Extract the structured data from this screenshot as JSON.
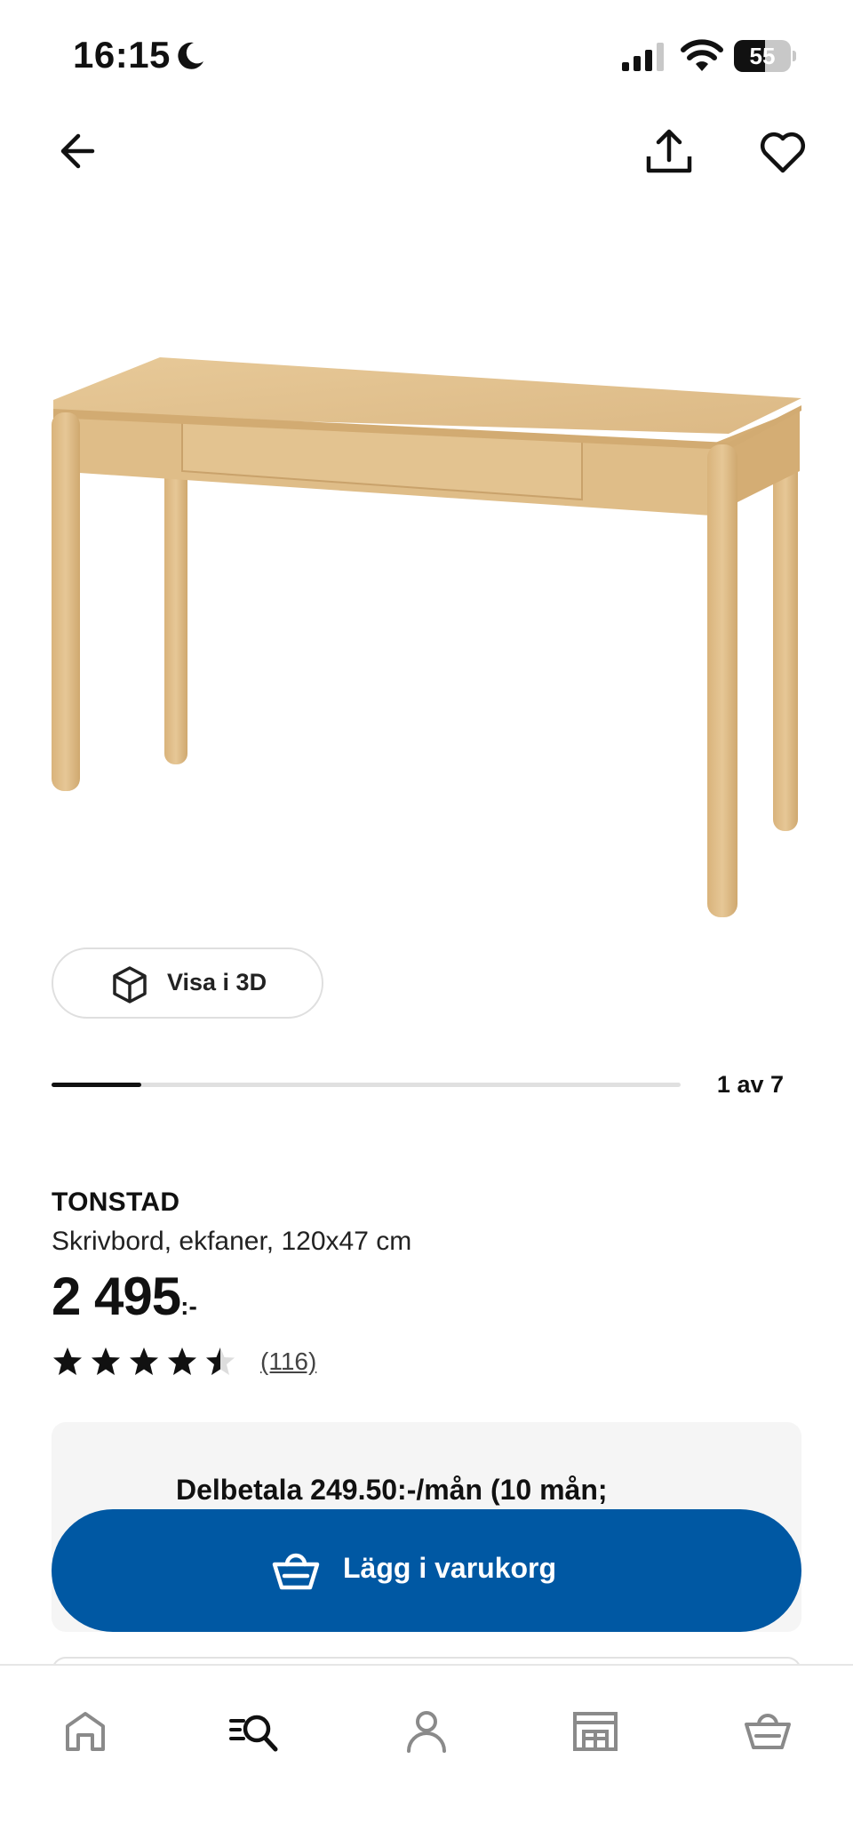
{
  "status_bar": {
    "time": "16:15",
    "battery_level": "55",
    "battery_fraction": 0.55,
    "icons": [
      "moon-icon",
      "signal-icon",
      "wifi-icon",
      "battery-icon"
    ]
  },
  "top_nav": {
    "icons": [
      "back-arrow-icon",
      "share-icon",
      "heart-icon"
    ]
  },
  "gallery": {
    "view_3d_label": "Visa i 3D",
    "counter": "1 av 7",
    "current_index": 1,
    "total_images": 7
  },
  "product": {
    "name": "TONSTAD",
    "description": "Skrivbord, ekfaner, 120x47 cm",
    "price_main": "2 495",
    "price_suffix": ":-",
    "rating_value": 4.5,
    "rating_max": 5,
    "review_count": "(116)"
  },
  "installment": {
    "text": "Delbetala 249.50:-/mån (10 mån;"
  },
  "cart_button": {
    "label": "Lägg i varukorg"
  },
  "tab_bar": {
    "icons": [
      "home-icon",
      "search-icon",
      "profile-icon",
      "store-icon",
      "basket-icon"
    ],
    "active": "search-icon"
  },
  "colors": {
    "accent": "#0058a3",
    "text": "#111111",
    "card_background": "#f5f5f5",
    "wood": "#e0c08e"
  }
}
